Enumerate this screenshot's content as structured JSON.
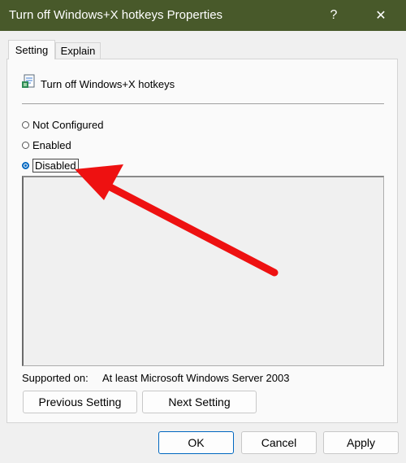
{
  "window": {
    "title": "Turn off Windows+X hotkeys Properties",
    "help_label": "?",
    "close_label": "✕"
  },
  "tabs": [
    {
      "label": "Setting",
      "active": true
    },
    {
      "label": "Explain",
      "active": false
    }
  ],
  "policy": {
    "name": "Turn off Windows+X hotkeys",
    "icon": "policy-setting-icon"
  },
  "options": [
    {
      "label": "Not Configured",
      "checked": false
    },
    {
      "label": "Enabled",
      "checked": false
    },
    {
      "label": "Disabled",
      "checked": true
    }
  ],
  "supported": {
    "label": "Supported on:",
    "value": "At least Microsoft Windows Server 2003"
  },
  "nav_buttons": {
    "previous": "Previous Setting",
    "next": "Next Setting"
  },
  "dialog_buttons": {
    "ok": "OK",
    "cancel": "Cancel",
    "apply": "Apply"
  },
  "colors": {
    "titlebar": "#48592a",
    "accent": "#0067c0",
    "annotation_arrow": "#ee1111"
  }
}
